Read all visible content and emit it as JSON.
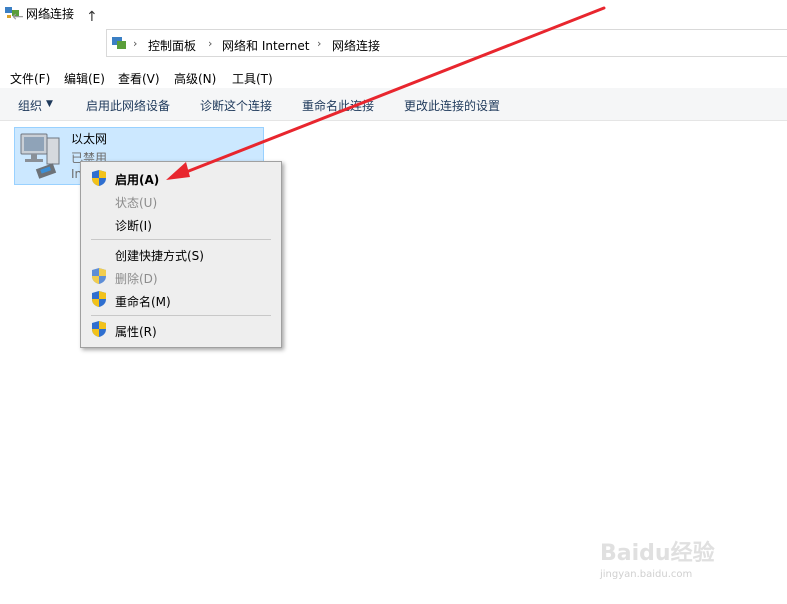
{
  "window": {
    "title": "网络连接"
  },
  "breadcrumb": [
    "控制面板",
    "网络和 Internet",
    "网络连接"
  ],
  "menubar": [
    "文件(F)",
    "编辑(E)",
    "查看(V)",
    "高级(N)",
    "工具(T)"
  ],
  "commands": {
    "organize": "组织",
    "enable_device": "启用此网络设备",
    "diagnose": "诊断这个连接",
    "rename": "重命名此连接",
    "change_settings": "更改此连接的设置"
  },
  "item": {
    "name": "以太网",
    "status": "已禁用",
    "device": "In"
  },
  "context_menu": {
    "enable": "启用(A)",
    "status": "状态(U)",
    "diagnose": "诊断(I)",
    "shortcut": "创建快捷方式(S)",
    "delete": "删除(D)",
    "rename": "重命名(M)",
    "properties": "属性(R)"
  },
  "watermark": {
    "brand": "Baidu经验",
    "url": "jingyan.baidu.com"
  },
  "colors": {
    "selection": "#cce8ff",
    "arrow": "#e8262e",
    "menu_bg": "#eeeeee"
  }
}
